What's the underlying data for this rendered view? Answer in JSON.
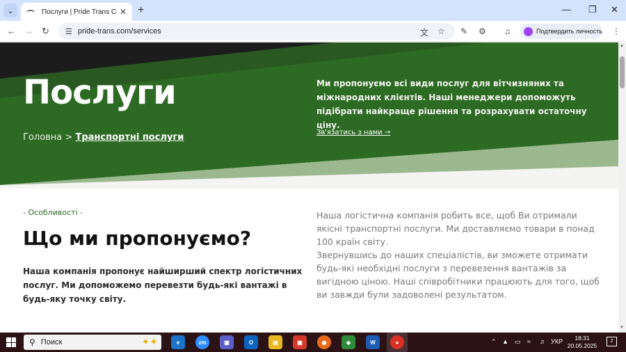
{
  "browser": {
    "tab_title": "Послуги | Pride Trans Company",
    "url": "pride-trans.com/services",
    "profile_label": "Подтвердить личность"
  },
  "hero": {
    "title": "Послуги",
    "breadcrumb_home": "Головна",
    "breadcrumb_separator": ">",
    "breadcrumb_current": "Транспортні послуги",
    "description": "Ми пропонуємо всі види послуг для вітчизняних та міжнародних клієнтів. Наші менеджери допоможуть підібрати найкраще рішення та розрахувати остаточну ціну.",
    "contact_link": "Зв'язатись з нами →",
    "colors": {
      "green": "#2d6a24",
      "dark": "#1c1c1c",
      "light_green": "#9bb88f"
    }
  },
  "features": {
    "tag": "- Особливості -",
    "title": "Що ми пропонуємо?",
    "lead": "Наша компанія пропонує найширший спектр логістичних послуг. Ми допоможемо перевезти будь-які вантажі в будь-яку точку світу.",
    "paragraph_1": "Наша логістична компанія робить все, щоб Ви отримали якісні транспортні послуги. Ми доставляємо товари в понад 100 країн світу.",
    "paragraph_2": "Звернувшись до наших спеціалістів, ви зможете отримати будь-які необхідні послуги з перевезення вантажів за вигідною ціною. Наші співробітники працюють для того, щоб ви завжди були задоволені результатом."
  },
  "taskbar": {
    "search_placeholder": "Поиск",
    "language": "УКР",
    "time": "18:31",
    "date": "20.05.2025",
    "notification_count": "2"
  }
}
